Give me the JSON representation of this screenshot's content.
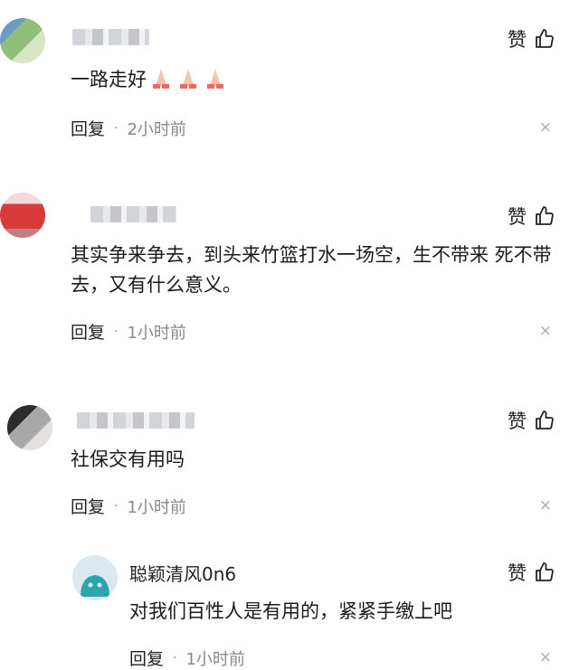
{
  "comments": [
    {
      "like_label": "赞",
      "text": "一路走好",
      "emoji": [
        "folded-hands",
        "folded-hands",
        "folded-hands"
      ],
      "reply_label": "回复",
      "time": "2小时前",
      "close": "×"
    },
    {
      "like_label": "赞",
      "text": "其实争来争去，到头来竹篮打水一场空，生不带来 死不带去，又有什么意义。",
      "reply_label": "回复",
      "time": "1小时前",
      "close": "×"
    },
    {
      "like_label": "赞",
      "text": "社保交有用吗",
      "reply_label": "回复",
      "time": "1小时前",
      "close": "×"
    }
  ],
  "reply": {
    "username": "聪颖清风0n6",
    "like_label": "赞",
    "text": "对我们百性人是有用的，紧紧手缴上吧",
    "reply_label": "回复",
    "time": "1小时前",
    "close": "×"
  },
  "colors": {
    "reply_avatar_bg": "#dbe8ef",
    "reply_avatar_fg": "#2aa6ad"
  }
}
